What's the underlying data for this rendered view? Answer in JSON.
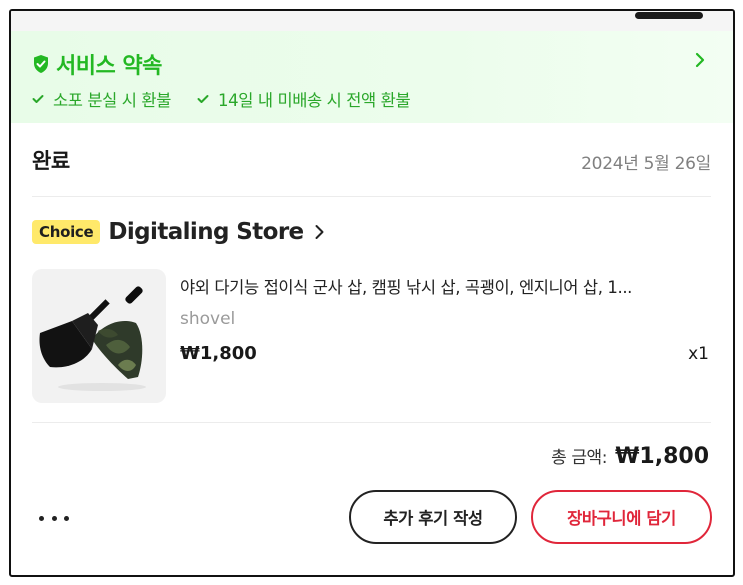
{
  "service": {
    "title": "서비스 약속",
    "promises": [
      "소포 분실 시 환불",
      "14일 내 미배송 시 전액 환불"
    ],
    "accent_color": "#23b823"
  },
  "order": {
    "status": "완료",
    "date": "2024년 5월 26일"
  },
  "store": {
    "badge": "Choice",
    "name": "Digitaling Store"
  },
  "product": {
    "title": "야외 다기능 접이식 군사 삽, 캠핑 낚시 삽, 곡괭이, 엔지니어 삽, 1...",
    "variant": "shovel",
    "price": "₩1,800",
    "quantity": "x1",
    "image_icon": "folding-shovel-image"
  },
  "summary": {
    "total_label": "총 금액:",
    "total_value": "₩1,800"
  },
  "actions": {
    "more_icon": "more-dots-icon",
    "review_label": "추가 후기 작성",
    "cart_label": "장바구니에 담기",
    "cart_color": "#e0263a"
  }
}
